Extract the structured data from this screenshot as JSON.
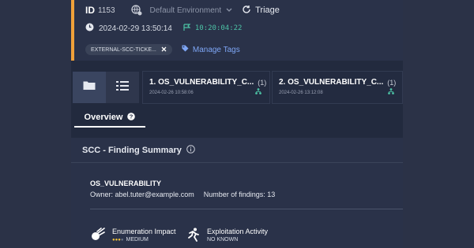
{
  "header": {
    "id_label": "ID",
    "id_value": "1153",
    "environment": "Default Environment",
    "triage_label": "Triage",
    "timestamp": "2024-02-29 13:50:14",
    "duration": "10:20:04:22",
    "tag": "EXTERNAL-SCC-TICKE...",
    "manage_tags": "Manage Tags"
  },
  "finding_tabs": [
    {
      "title": "1. OS_VULNERABILITY_C...",
      "count": "(1)",
      "date": "2024-02-26 10:58:06"
    },
    {
      "title": "2. OS_VULNERABILITY_C...",
      "count": "(1)",
      "date": "2024-02-26 13:12:08"
    }
  ],
  "overview_tab": "Overview",
  "section": {
    "title": "SCC - Finding Summary",
    "finding_name": "OS_VULNERABILITY",
    "owner": "Owner: abel.tuter@example.com",
    "findings_count": "Number of findings: 13"
  },
  "metrics": [
    {
      "title": "Enumeration Impact",
      "value": "MEDIUM",
      "icon": "meteor-icon"
    },
    {
      "title": "Exploitation Activity",
      "value": "NO KNOWN",
      "icon": "running-person-icon"
    }
  ],
  "colors": {
    "accent": "#f0a13a",
    "link": "#7ea6f5",
    "duration": "#4cc2a5"
  }
}
